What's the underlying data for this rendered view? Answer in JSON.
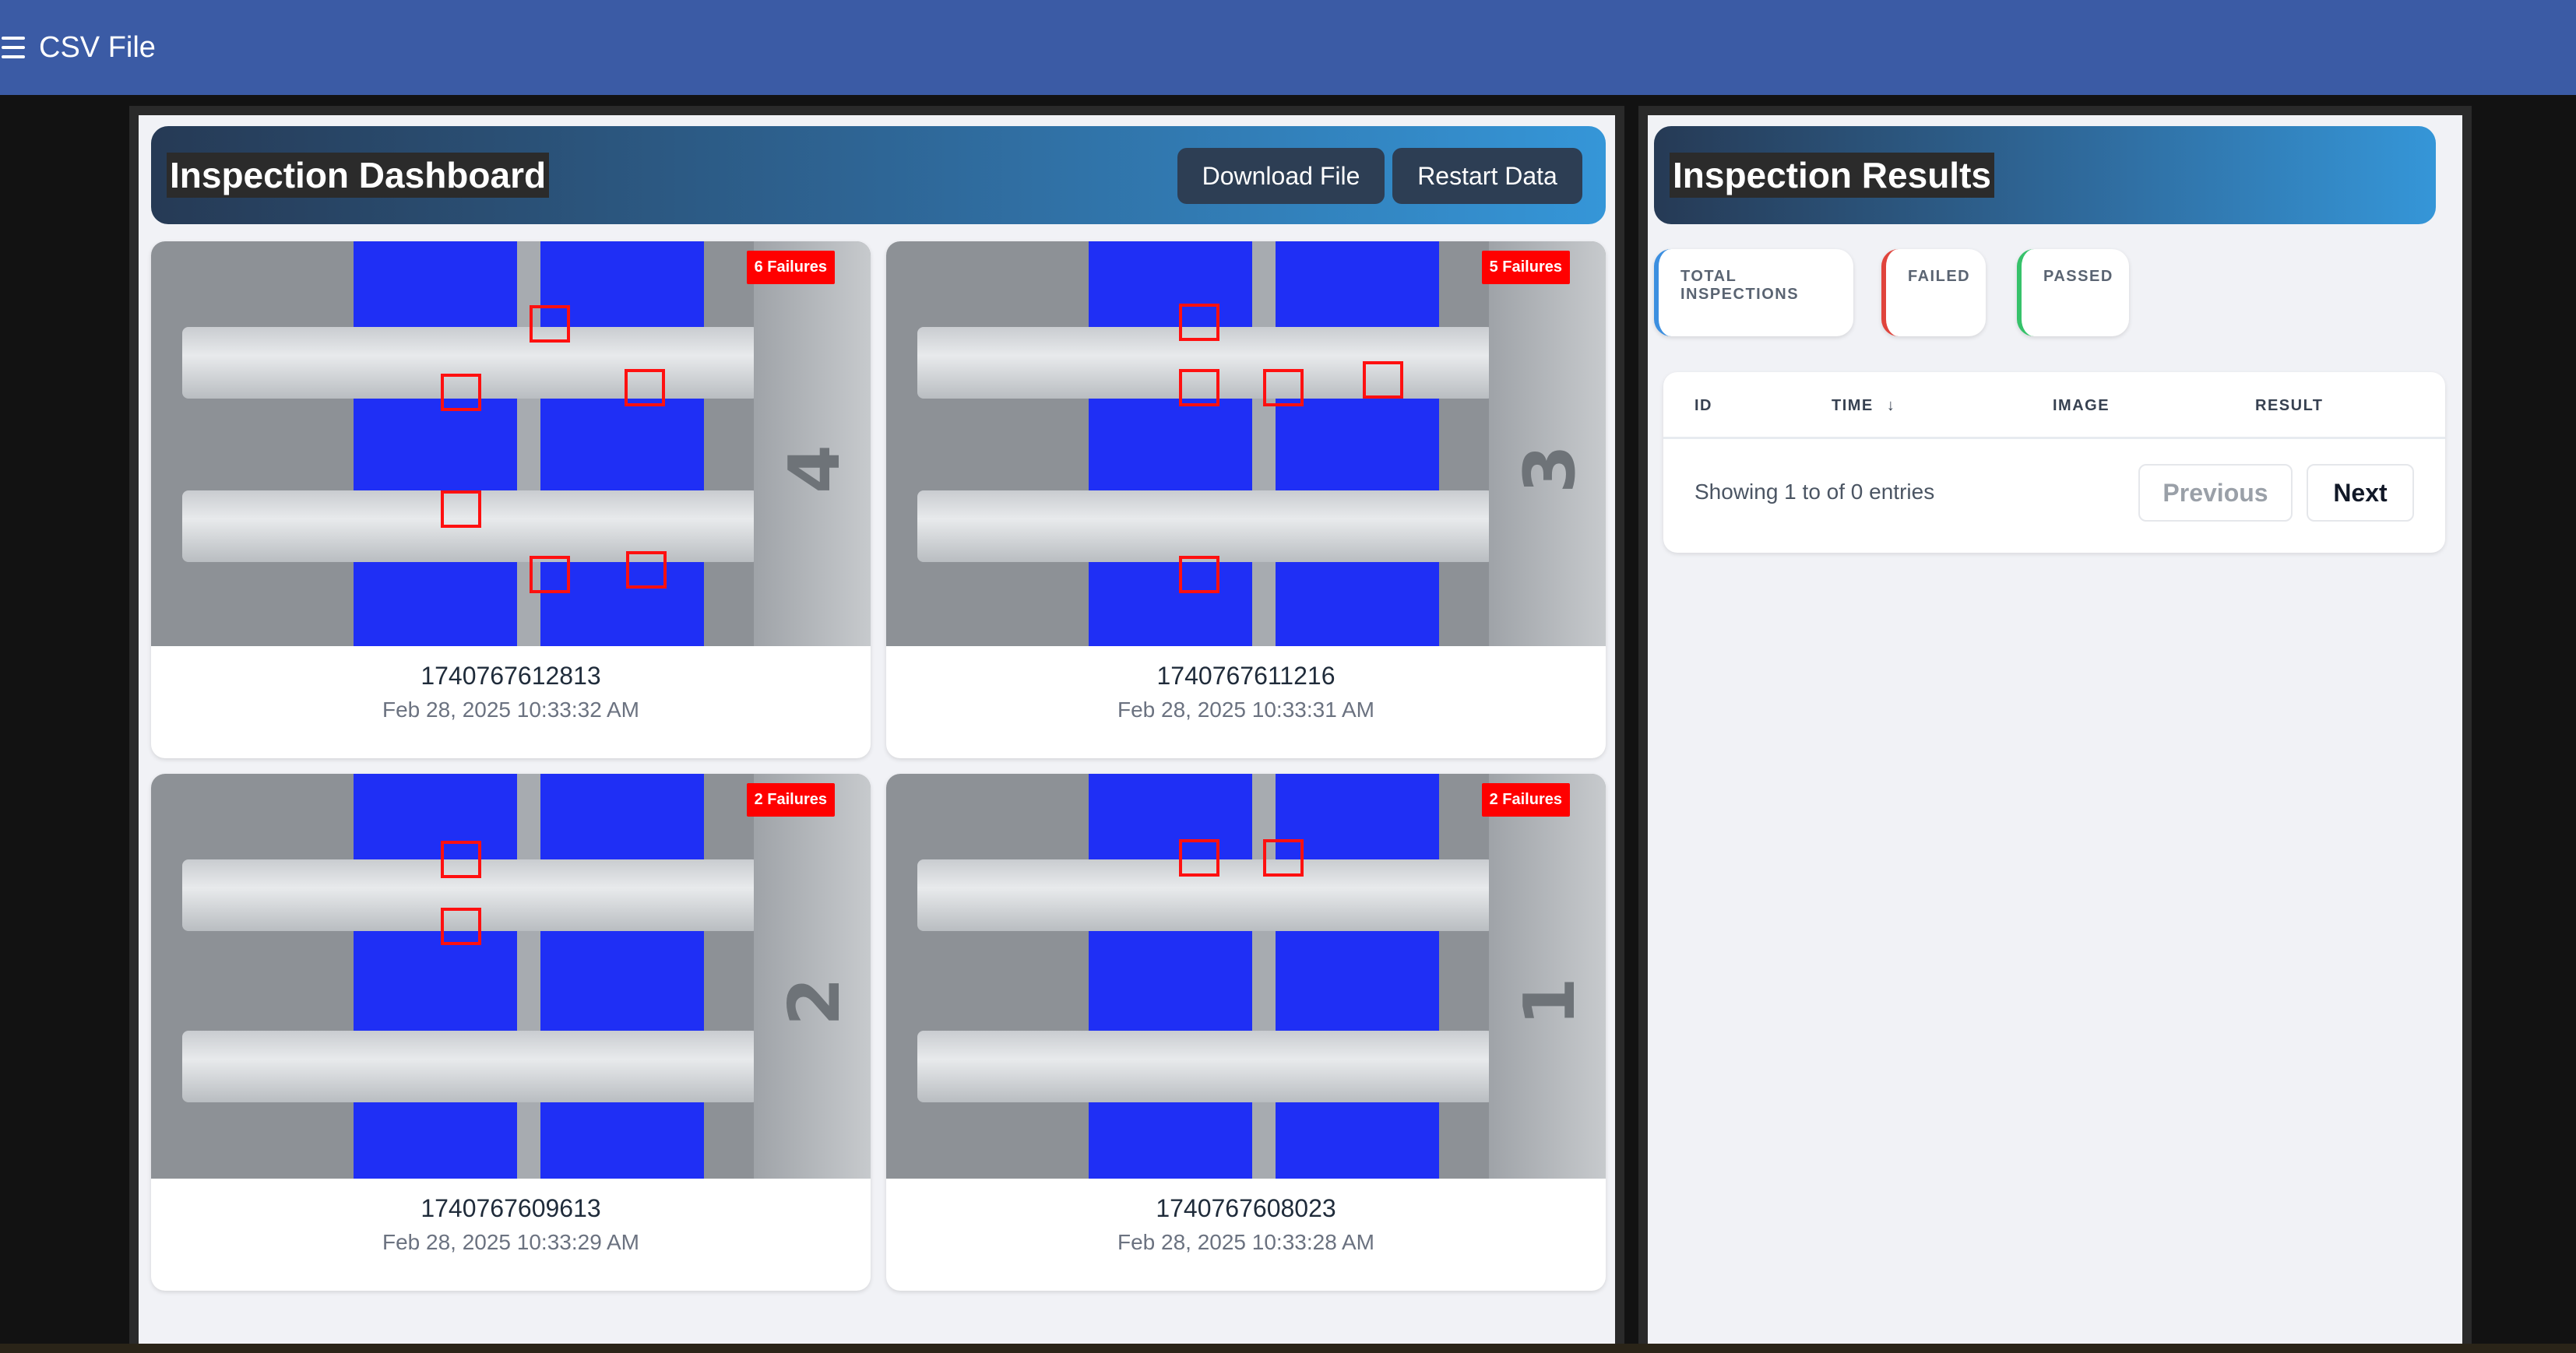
{
  "topbar": {
    "title": "CSV File",
    "menu_icon": "hamburger-icon"
  },
  "dashboard": {
    "title": "Inspection Dashboard",
    "download_label": "Download File",
    "restart_label": "Restart Data",
    "cards": [
      {
        "id": "1740767612813",
        "time": "Feb 28, 2025 10:33:32 AM",
        "badge": "6 Failures",
        "numeral": "4"
      },
      {
        "id": "1740767611216",
        "time": "Feb 28, 2025 10:33:31 AM",
        "badge": "5 Failures",
        "numeral": "3"
      },
      {
        "id": "1740767609613",
        "time": "Feb 28, 2025 10:33:29 AM",
        "badge": "2 Failures",
        "numeral": "2"
      },
      {
        "id": "1740767608023",
        "time": "Feb 28, 2025 10:33:28 AM",
        "badge": "2 Failures",
        "numeral": "1"
      }
    ]
  },
  "results": {
    "title": "Inspection Results",
    "stats": {
      "total": "TOTAL INSPECTIONS",
      "failed": "FAILED",
      "passed": "PASSED"
    },
    "columns": {
      "id": "ID",
      "time": "TIME",
      "image": "IMAGE",
      "result": "RESULT"
    },
    "sort_icon": "arrow-down-icon",
    "showing": "Showing 1 to of 0 entries",
    "previous": "Previous",
    "next": "Next"
  },
  "colors": {
    "topbar": "#3b5ba5",
    "failure_badge": "#ff0000",
    "total_accent": "#3c8fe0",
    "failed_accent": "#e0443c",
    "passed_accent": "#36c26a"
  }
}
